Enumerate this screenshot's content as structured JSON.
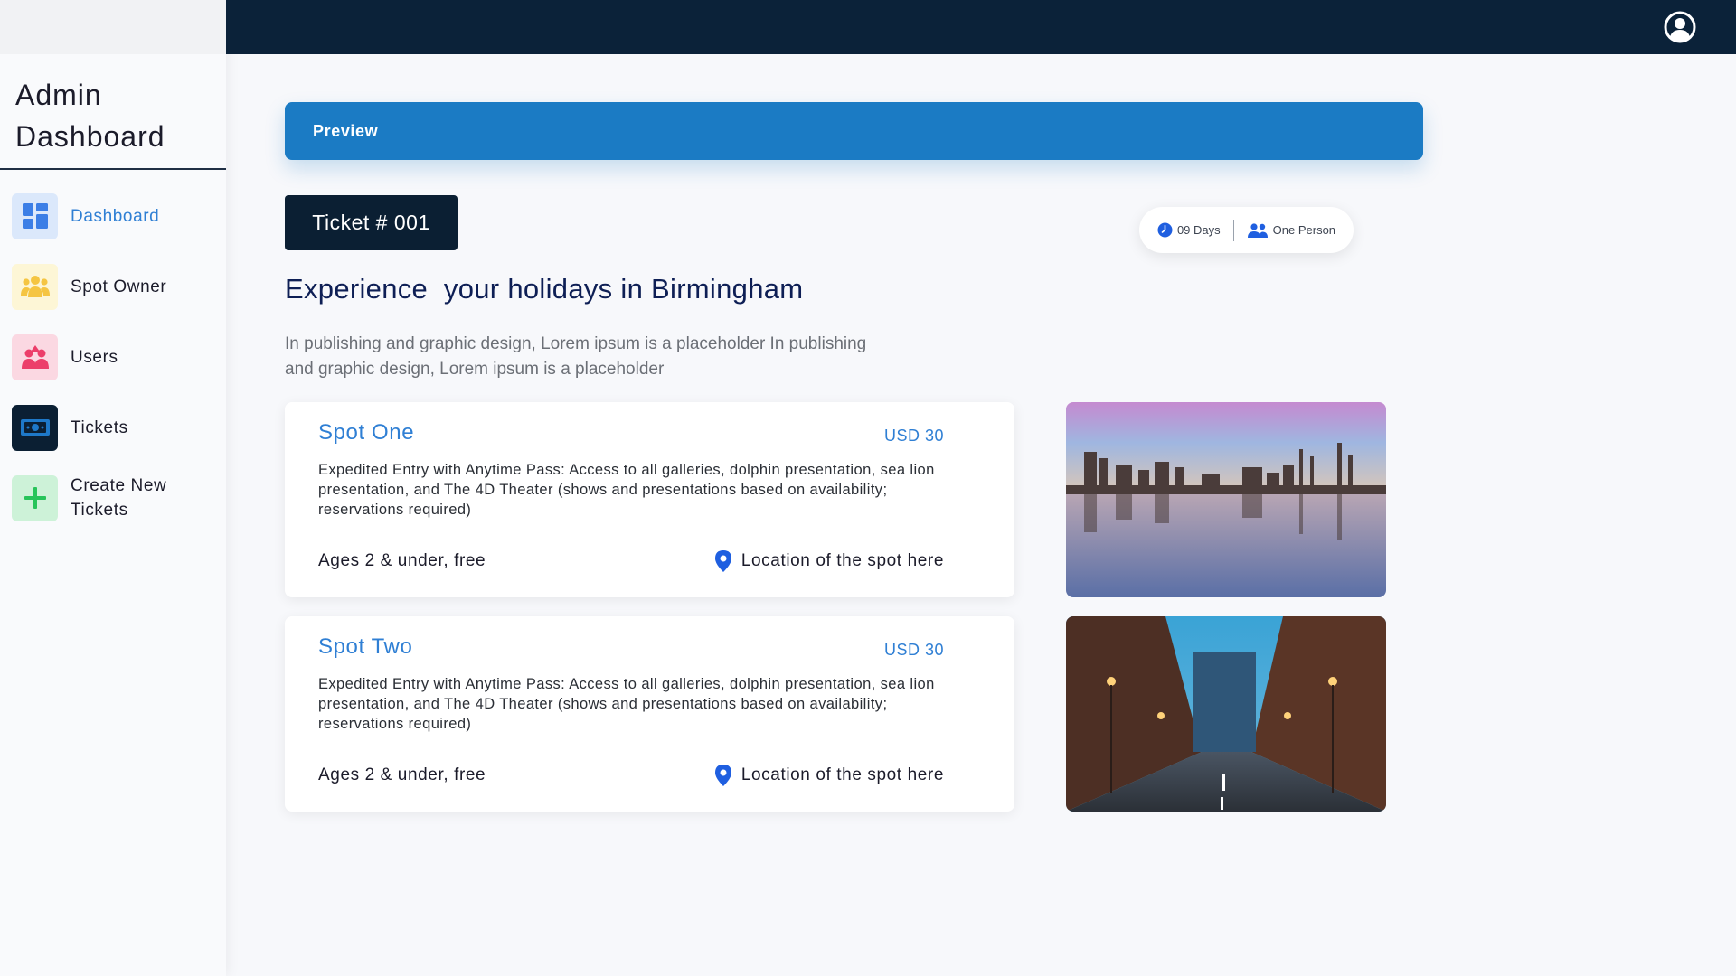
{
  "app": {
    "title_line1": "Admin",
    "title_line2": "Dashboard"
  },
  "sidebar": {
    "items": [
      {
        "label": "Dashboard",
        "icon": "dashboard-grid-icon",
        "active": true,
        "icon_bg": "#dbe8fb",
        "icon_color": "#3b7ee6"
      },
      {
        "label": "Spot Owner",
        "icon": "people-group-icon",
        "active": false,
        "icon_bg": "#fdf6d6",
        "icon_color": "#f5c542"
      },
      {
        "label": "Users",
        "icon": "users-icon",
        "active": false,
        "icon_bg": "#fbd8e2",
        "icon_color": "#ec3e6a"
      },
      {
        "label": "Tickets",
        "icon": "ticket-money-icon",
        "active": false,
        "icon_bg": "#0b1f33",
        "icon_color": "#1e78c8"
      },
      {
        "label": "Create New Tickets",
        "icon": "plus-icon",
        "active": false,
        "icon_bg": "#cdf2d8",
        "icon_color": "#27c45a"
      }
    ]
  },
  "header": {
    "user_icon": "account-circle-icon"
  },
  "main": {
    "preview_label": "Preview",
    "ticket_label": "Ticket # 001",
    "duration": "09 Days",
    "persons": "One Person",
    "headline": "Experience  your holidays in Birmingham",
    "intro": "In publishing and graphic design, Lorem ipsum is a placeholder In publishing and graphic design, Lorem ipsum is a placeholder",
    "spots": [
      {
        "title": "Spot One",
        "price": "USD 30",
        "description": "Expedited Entry with Anytime Pass: Access to all galleries, dolphin presentation, sea lion presentation, and The 4D Theater (shows and presentations based on availability; reservations required)",
        "ages": "Ages 2 & under, free",
        "location": "Location of the spot here",
        "photo": "city-skyline-lake-photo"
      },
      {
        "title": "Spot Two",
        "price": "USD 30",
        "description": "Expedited Entry with Anytime Pass: Access to all galleries, dolphin presentation, sea lion presentation, and The 4D Theater (shows and presentations based on availability; reservations required)",
        "ages": "Ages 2 & under, free",
        "location": "Location of the spot here",
        "photo": "city-street-night-photo"
      }
    ]
  },
  "colors": {
    "topbar": "#0b2239",
    "accent": "#2f7fd4",
    "preview_bar": "#1b7bc4",
    "ticket_badge": "#0b1f33",
    "headline": "#0e1f55"
  }
}
